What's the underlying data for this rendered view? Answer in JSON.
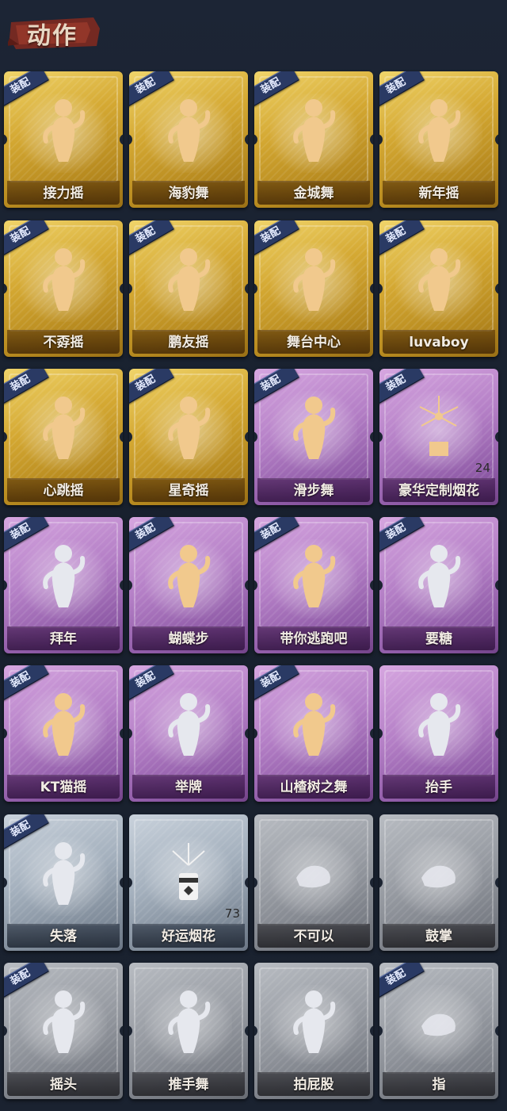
{
  "header": {
    "title": "动作",
    "banner_color": "#8a2f24"
  },
  "equip_badge_label": "装配",
  "tier_colors": {
    "gold": "#d4a832",
    "purple": "#b47fc6",
    "silver": "#a4b0bd",
    "grey": "#989ca3"
  },
  "cards": [
    {
      "label": "接力摇",
      "tier": "gold",
      "equipped": true,
      "icon": "dance-figure-icon",
      "count": ""
    },
    {
      "label": "海豹舞",
      "tier": "gold",
      "equipped": true,
      "icon": "dance-figure-icon",
      "count": ""
    },
    {
      "label": "金城舞",
      "tier": "gold",
      "equipped": true,
      "icon": "dance-figure-icon",
      "count": ""
    },
    {
      "label": "新年摇",
      "tier": "gold",
      "equipped": true,
      "icon": "dance-figure-icon",
      "count": ""
    },
    {
      "label": "不孬摇",
      "tier": "gold",
      "equipped": true,
      "icon": "dance-figure-icon",
      "count": ""
    },
    {
      "label": "鹏友摇",
      "tier": "gold",
      "equipped": true,
      "icon": "dance-figure-icon",
      "count": ""
    },
    {
      "label": "舞台中心",
      "tier": "gold",
      "equipped": true,
      "icon": "dance-figure-icon",
      "count": ""
    },
    {
      "label": "luvaboy",
      "tier": "gold",
      "equipped": true,
      "icon": "dance-figure-icon",
      "count": ""
    },
    {
      "label": "心跳摇",
      "tier": "gold",
      "equipped": true,
      "icon": "dance-figure-icon",
      "count": ""
    },
    {
      "label": "星奇摇",
      "tier": "gold",
      "equipped": true,
      "icon": "dance-figure-icon",
      "count": ""
    },
    {
      "label": "滑步舞",
      "tier": "purple",
      "equipped": true,
      "icon": "dance-figure-icon",
      "count": ""
    },
    {
      "label": "豪华定制烟花",
      "tier": "purple",
      "equipped": true,
      "icon": "fireworks-icon",
      "count": "24"
    },
    {
      "label": "拜年",
      "tier": "purple",
      "equipped": true,
      "icon": "bow-figure-icon",
      "count": ""
    },
    {
      "label": "蝴蝶步",
      "tier": "purple",
      "equipped": true,
      "icon": "dance-figure-icon",
      "count": ""
    },
    {
      "label": "带你逃跑吧",
      "tier": "purple",
      "equipped": true,
      "icon": "dance-figure-icon",
      "count": ""
    },
    {
      "label": "要糖",
      "tier": "purple",
      "equipped": true,
      "icon": "reach-figure-icon",
      "count": ""
    },
    {
      "label": "KT猫摇",
      "tier": "purple",
      "equipped": true,
      "icon": "dance-figure-icon",
      "count": ""
    },
    {
      "label": "举牌",
      "tier": "purple",
      "equipped": true,
      "icon": "sign-figure-icon",
      "count": ""
    },
    {
      "label": "山楂树之舞",
      "tier": "purple",
      "equipped": true,
      "icon": "dance-figure-icon",
      "count": ""
    },
    {
      "label": "抬手",
      "tier": "purple",
      "equipped": false,
      "icon": "raise-hand-figure-icon",
      "count": ""
    },
    {
      "label": "失落",
      "tier": "silver",
      "equipped": true,
      "icon": "crawl-figure-icon",
      "count": ""
    },
    {
      "label": "好运烟花",
      "tier": "silver",
      "equipped": false,
      "icon": "firework-can-icon",
      "count": "73"
    },
    {
      "label": "不可以",
      "tier": "grey",
      "equipped": false,
      "icon": "finger-wag-icon",
      "count": ""
    },
    {
      "label": "鼓掌",
      "tier": "grey",
      "equipped": false,
      "icon": "clap-hands-icon",
      "count": ""
    },
    {
      "label": "摇头",
      "tier": "grey",
      "equipped": true,
      "icon": "shake-head-figure-icon",
      "count": ""
    },
    {
      "label": "推手舞",
      "tier": "grey",
      "equipped": false,
      "icon": "push-hands-figure-icon",
      "count": ""
    },
    {
      "label": "拍屁股",
      "tier": "grey",
      "equipped": false,
      "icon": "pat-figure-icon",
      "count": ""
    },
    {
      "label": "指",
      "tier": "grey",
      "equipped": true,
      "icon": "point-hand-icon",
      "count": ""
    }
  ]
}
